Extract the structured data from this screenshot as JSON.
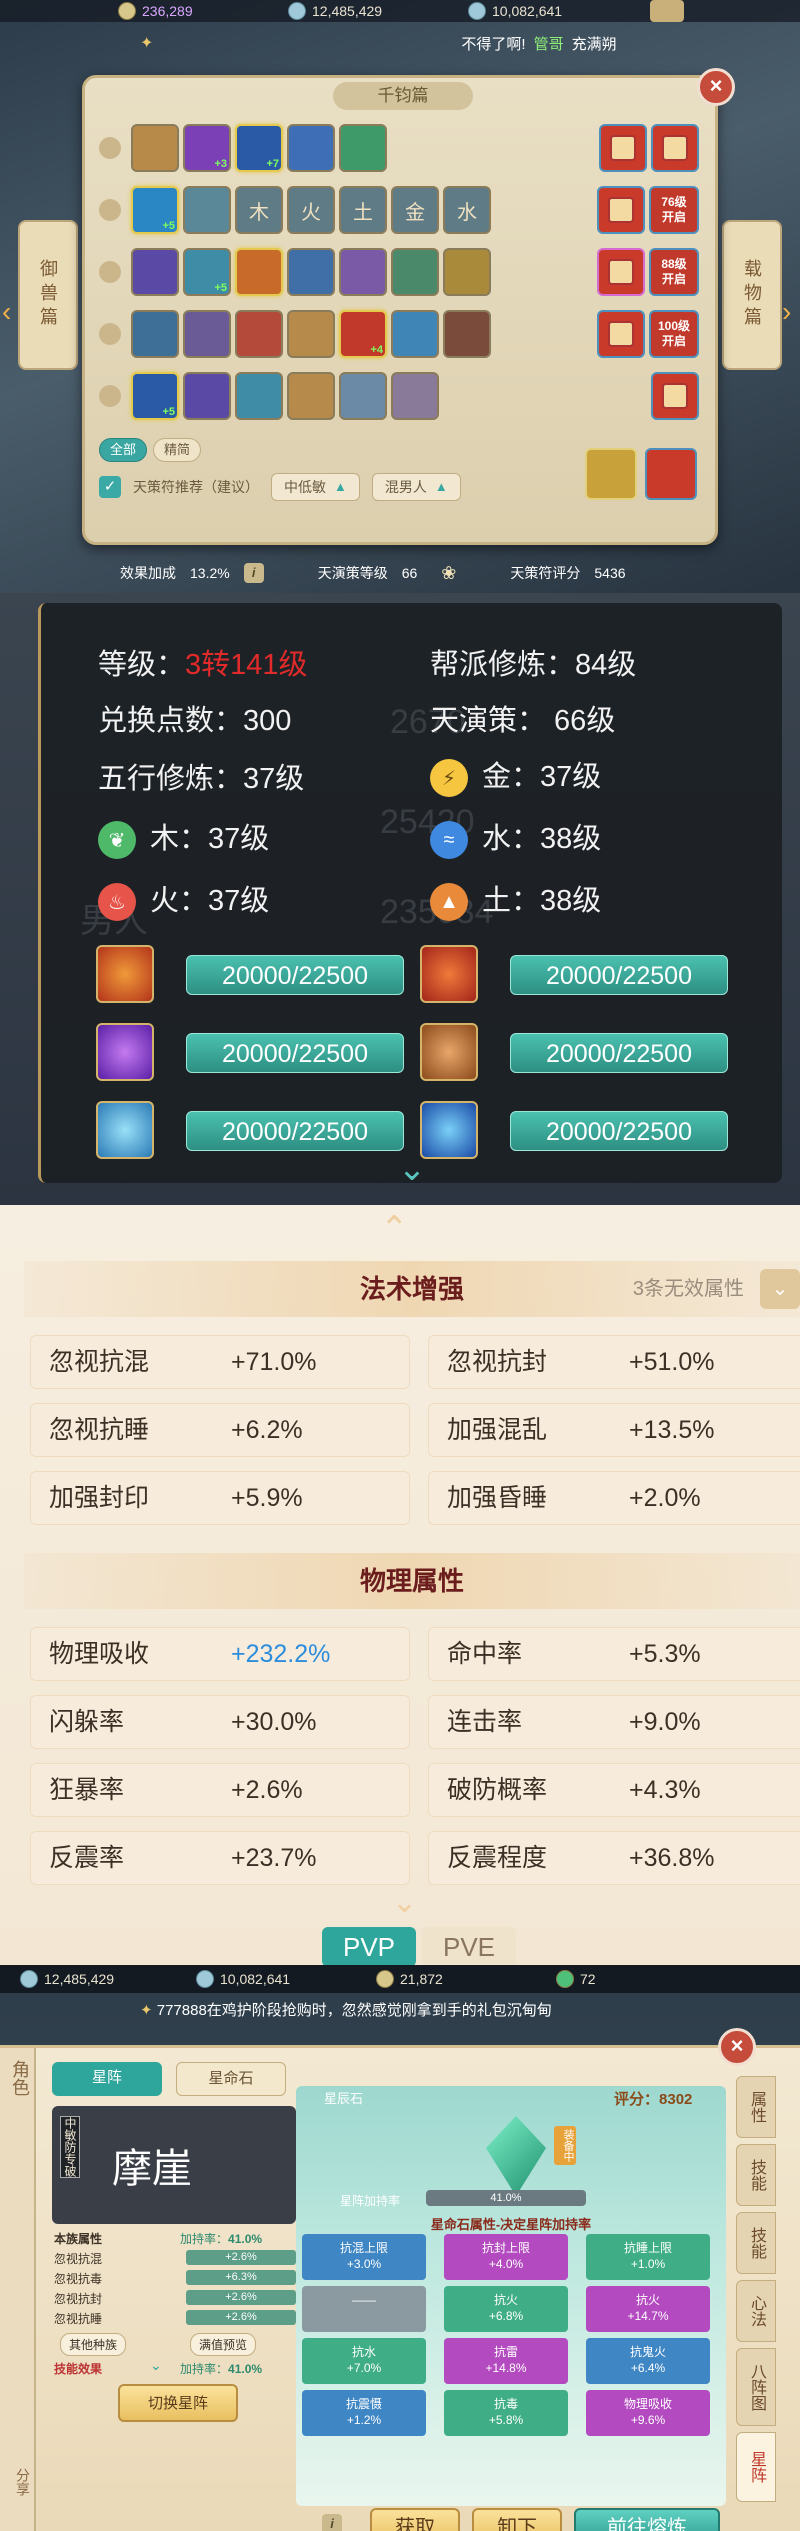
{
  "s1": {
    "currency": [
      "236,289",
      "12,485,429",
      "10,082,641"
    ],
    "notice_text": "不得了啊!",
    "notice_name": "管哥",
    "notice_end": "充满朔",
    "panel_title": "千钧篇",
    "side_left": "御兽篇",
    "side_right": "载物篇",
    "row_badges": [
      null,
      "76级\n开启",
      "88级\n开启",
      "100级\n开启",
      null
    ],
    "tabs": [
      "全部",
      "精简"
    ],
    "check_label": "天策符推荐（建议）",
    "dropdown1": "中低敏",
    "dropdown2": "混男人",
    "char_tiles": [
      "木",
      "火",
      "土",
      "金",
      "水"
    ],
    "footer": {
      "effect_label": "效果加成",
      "effect_value": "13.2%",
      "level_label": "天演策等级",
      "level_value": "66",
      "score_label": "天策符评分",
      "score_value": "5436"
    }
  },
  "s2": {
    "level_label": "等级：",
    "level_value": "3转141级",
    "bangpai": "帮派修炼：84级",
    "exchange": "兑换点数：300",
    "tianyan": "天演策：  66级",
    "wuxing": "五行修炼：37级",
    "jin": "金：37级",
    "mu": "木：37级",
    "shui": "水：38级",
    "huo": "火：37级",
    "tu": "土：38级",
    "bars": [
      "20000/22500",
      "20000/22500",
      "20000/22500",
      "20000/22500",
      "20000/22500",
      "20000/22500"
    ],
    "ghost": [
      "2670",
      "25420",
      "235034",
      "男人"
    ]
  },
  "s3": {
    "sec1_title": "法术增强",
    "sec1_right": "3条无效属性",
    "sec1": [
      {
        "k": "忽视抗混",
        "v": "+71.0%"
      },
      {
        "k": "忽视抗封",
        "v": "+51.0%"
      },
      {
        "k": "忽视抗睡",
        "v": "+6.2%"
      },
      {
        "k": "加强混乱",
        "v": "+13.5%"
      },
      {
        "k": "加强封印",
        "v": "+5.9%"
      },
      {
        "k": "加强昏睡",
        "v": "+2.0%"
      }
    ],
    "sec2_title": "物理属性",
    "sec2": [
      {
        "k": "物理吸收",
        "v": "+232.2%"
      },
      {
        "k": "命中率",
        "v": "+5.3%"
      },
      {
        "k": "闪躲率",
        "v": "+30.0%"
      },
      {
        "k": "连击率",
        "v": "+9.0%"
      },
      {
        "k": "狂暴率",
        "v": "+2.6%"
      },
      {
        "k": "破防概率",
        "v": "+4.3%"
      },
      {
        "k": "反震率",
        "v": "+23.7%"
      },
      {
        "k": "反震程度",
        "v": "+36.8%"
      }
    ],
    "tab_pvp": "PVP",
    "tab_pve": "PVE"
  },
  "s4": {
    "currency": [
      "12,485,429",
      "10,082,641",
      "21,872",
      "72"
    ],
    "marquee": "777888在鸡护阶段抢购时，忽然感觉刚拿到手的礼包沉甸甸",
    "left_rail": "角色",
    "left_rail2": "分享",
    "tab1": "星阵",
    "tab2": "星命石",
    "formation_sub": "中敏防专破",
    "formation_name": "摩崖",
    "stat_title": "本族属性",
    "stat_add_lbl": "加持率：",
    "stat_add": "41.0%",
    "stats": [
      {
        "k": "忽视抗混",
        "v": "+2.6%"
      },
      {
        "k": "忽视抗毒",
        "v": "+6.3%"
      },
      {
        "k": "忽视抗封",
        "v": "+2.6%"
      },
      {
        "k": "忽视抗睡",
        "v": "+2.6%"
      }
    ],
    "btn_other": "其他种族",
    "btn_full": "满值预览",
    "skill_lbl": "技能效果",
    "skill_add_lbl": "加持率：",
    "skill_add": "41.0%",
    "switch_btn": "切换星阵",
    "stone_name": "星辰石",
    "score_lbl": "评分：",
    "score": "8302",
    "equip_tag": "装备中",
    "rate_label": "星阵加持率",
    "rate_value": "41.0%",
    "decide_title": "星命石属性-决定星阵加持率",
    "tiles": [
      {
        "k": "抗混上限",
        "v": "+3.0%"
      },
      {
        "k": "抗封上限",
        "v": "+4.0%"
      },
      {
        "k": "抗睡上限",
        "v": "+1.0%"
      },
      {
        "k": "——",
        "v": ""
      },
      {
        "k": "抗火",
        "v": "+6.8%"
      },
      {
        "k": "抗火",
        "v": "+14.7%"
      },
      {
        "k": "抗水",
        "v": "+7.0%"
      },
      {
        "k": "抗雷",
        "v": "+14.8%"
      },
      {
        "k": "抗鬼火",
        "v": "+6.4%"
      },
      {
        "k": "抗震慑",
        "v": "+1.2%"
      },
      {
        "k": "抗毒",
        "v": "+5.8%"
      },
      {
        "k": "物理吸收",
        "v": "+9.6%"
      }
    ],
    "btn_get": "获取",
    "btn_unload": "卸下",
    "btn_smelt": "前往熔炼",
    "right_tabs": [
      "属性",
      "技能",
      "技能",
      "心法",
      "八阵图",
      "星阵"
    ]
  }
}
